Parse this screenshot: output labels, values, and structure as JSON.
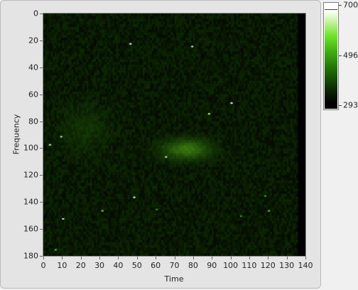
{
  "graph": {
    "xlabel": "Time",
    "ylabel": "Frequency",
    "x_ticks": [
      "0",
      "10",
      "20",
      "30",
      "40",
      "50",
      "60",
      "70",
      "80",
      "90",
      "100",
      "110",
      "120",
      "130",
      "140"
    ],
    "y_ticks": [
      "0",
      "20",
      "40",
      "60",
      "80",
      "100",
      "120",
      "140",
      "160",
      "180"
    ]
  },
  "colorscale": {
    "max_label": "700",
    "mid_label": "496",
    "min_label": "293",
    "colors": [
      "#000000",
      "#0b2a03",
      "#1f6a06",
      "#3fae10",
      "#6fe32a",
      "#ffffff"
    ]
  },
  "chart_data": {
    "type": "heatmap",
    "xlabel": "Time",
    "ylabel": "Frequency",
    "xlim": [
      0,
      140
    ],
    "ylim": [
      180,
      0
    ],
    "data_x_extent": [
      0,
      136
    ],
    "data_y_extent": [
      0,
      180
    ],
    "zlim": [
      293,
      700
    ],
    "blob": {
      "x_center": 76,
      "y_center": 100,
      "x_spread": 12,
      "y_spread": 7,
      "peak": 430
    },
    "faint_region": {
      "x_center": 22,
      "y_center": 85,
      "x_spread": 12,
      "y_spread": 18,
      "peak": 340
    },
    "background_level": 315,
    "hot_pixels": [
      {
        "x": 46,
        "y": 22,
        "v": 700
      },
      {
        "x": 79,
        "y": 24,
        "v": 640
      },
      {
        "x": 100,
        "y": 66,
        "v": 700
      },
      {
        "x": 88,
        "y": 74,
        "v": 620
      },
      {
        "x": 3,
        "y": 97,
        "v": 650
      },
      {
        "x": 9,
        "y": 91,
        "v": 600
      },
      {
        "x": 65,
        "y": 106,
        "v": 620
      },
      {
        "x": 48,
        "y": 136,
        "v": 700
      },
      {
        "x": 31,
        "y": 146,
        "v": 560
      },
      {
        "x": 10,
        "y": 152,
        "v": 640
      },
      {
        "x": 6,
        "y": 175,
        "v": 520
      },
      {
        "x": 120,
        "y": 146,
        "v": 520
      },
      {
        "x": 118,
        "y": 135,
        "v": 480
      },
      {
        "x": 105,
        "y": 150,
        "v": 470
      },
      {
        "x": 60,
        "y": 145,
        "v": 470
      }
    ]
  }
}
